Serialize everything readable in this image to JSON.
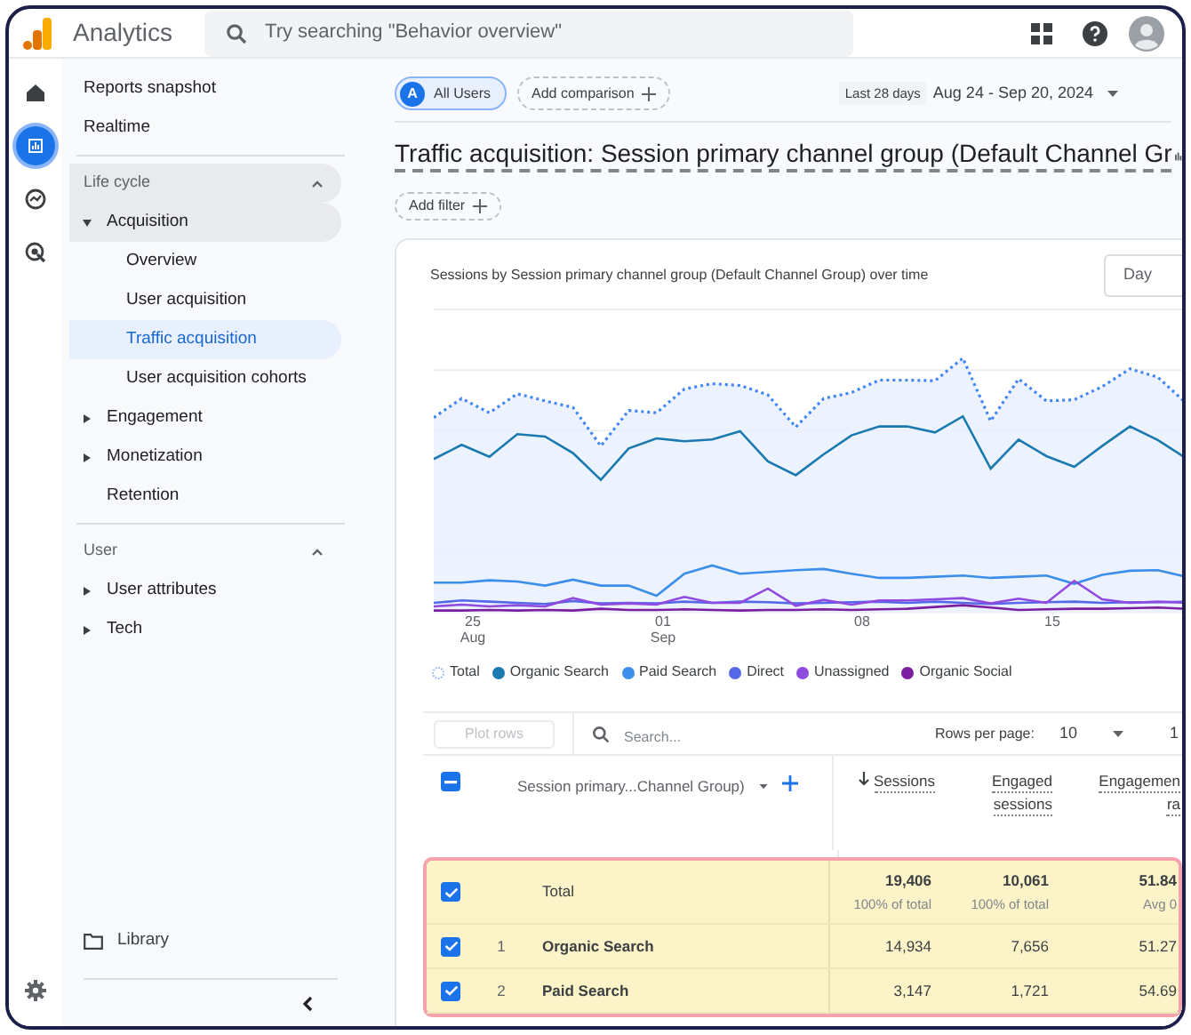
{
  "top_bar": {
    "product": "Analytics",
    "search": {
      "placeholder": "Try searching \"Behavior overview\""
    }
  },
  "rail": [
    {
      "kind": "home",
      "selected": false
    },
    {
      "kind": "reports",
      "selected": true
    },
    {
      "kind": "explore",
      "selected": false
    },
    {
      "kind": "advertising",
      "selected": false
    }
  ],
  "sidebar": {
    "items": [
      {
        "label": "Reports snapshot",
        "selected": false
      },
      {
        "label": "Realtime",
        "selected": false
      }
    ],
    "sections": [
      {
        "title": "Life cycle",
        "expanded": true,
        "highlighted": true,
        "items": [
          {
            "label": "Acquisition",
            "expanded": true,
            "highlighted": true,
            "selected": false,
            "children": [
              {
                "label": "Overview",
                "selected": false
              },
              {
                "label": "User acquisition",
                "selected": false
              },
              {
                "label": "Traffic acquisition",
                "selected": true
              },
              {
                "label": "User acquisition cohorts",
                "selected": false
              }
            ]
          },
          {
            "label": "Engagement",
            "expanded": false,
            "highlighted": false,
            "selected": false
          },
          {
            "label": "Monetization",
            "expanded": false,
            "highlighted": false,
            "selected": false
          },
          {
            "label": "Retention",
            "highlighted": false,
            "selected": false
          }
        ]
      },
      {
        "title": "User",
        "expanded": true,
        "highlighted": false,
        "items": [
          {
            "label": "User attributes",
            "expanded": false,
            "highlighted": false,
            "selected": false
          },
          {
            "label": "Tech",
            "expanded": false,
            "highlighted": false,
            "selected": false
          }
        ]
      }
    ],
    "library": "Library"
  },
  "segment": {
    "avatar": "A",
    "label": "All Users"
  },
  "add_comparison": "Add comparison",
  "date": {
    "range_label": "Last 28 days",
    "range": "Aug 24 - Sep 20, 2024"
  },
  "title": "Traffic acquisition: Session primary channel group (Default Channel Gr",
  "add_filter": "Add filter",
  "chart": {
    "title": "Sessions by Session primary channel group (Default Channel Group) over time",
    "granularity": "Day",
    "x_labels": [
      {
        "day": "25",
        "month": "Aug"
      },
      {
        "day": "01",
        "month": "Sep"
      },
      {
        "day": "08"
      },
      {
        "day": "15"
      }
    ],
    "legend": [
      {
        "label": "Total",
        "color": "#8ab4f8",
        "kind": "ring"
      },
      {
        "label": "Organic Search",
        "color": "#1a7ab0",
        "kind": "dot"
      },
      {
        "label": "Paid Search",
        "color": "#3b8eea",
        "kind": "dot"
      },
      {
        "label": "Direct",
        "color": "#5468e8",
        "kind": "dot"
      },
      {
        "label": "Unassigned",
        "color": "#8f4ae0",
        "kind": "dot"
      },
      {
        "label": "Organic Social",
        "color": "#7a1fa0",
        "kind": "dot"
      }
    ]
  },
  "table": {
    "plot_rows": {
      "label": "Plot rows",
      "disabled": true
    },
    "search_placeholder": "Search...",
    "rows_per_page_label": "Rows per page:",
    "rows_per_page": "10",
    "page": "1",
    "header_checkbox": {
      "indeterminate": true
    },
    "dimension_column": "Session primary...Channel Group)",
    "columns": [
      {
        "lines": [
          "Sessions"
        ],
        "sorted": true
      },
      {
        "lines": [
          "Engaged",
          "sessions"
        ],
        "sorted": false
      },
      {
        "lines": [
          "Engagemen",
          "ra"
        ],
        "sorted": false
      }
    ],
    "highlighted": true,
    "total": {
      "label": "Total",
      "checked": true,
      "values": [
        {
          "value": "19,406",
          "note": "100% of total"
        },
        {
          "value": "10,061",
          "note": "100% of total"
        },
        {
          "value": "51.84",
          "note": "Avg 0"
        }
      ]
    },
    "rows": [
      {
        "index": "1",
        "label": "Organic Search",
        "checked": true,
        "values": [
          "14,934",
          "7,656",
          "51.27"
        ]
      },
      {
        "index": "2",
        "label": "Paid Search",
        "checked": true,
        "values": [
          "3,147",
          "1,721",
          "54.69"
        ]
      }
    ]
  }
}
